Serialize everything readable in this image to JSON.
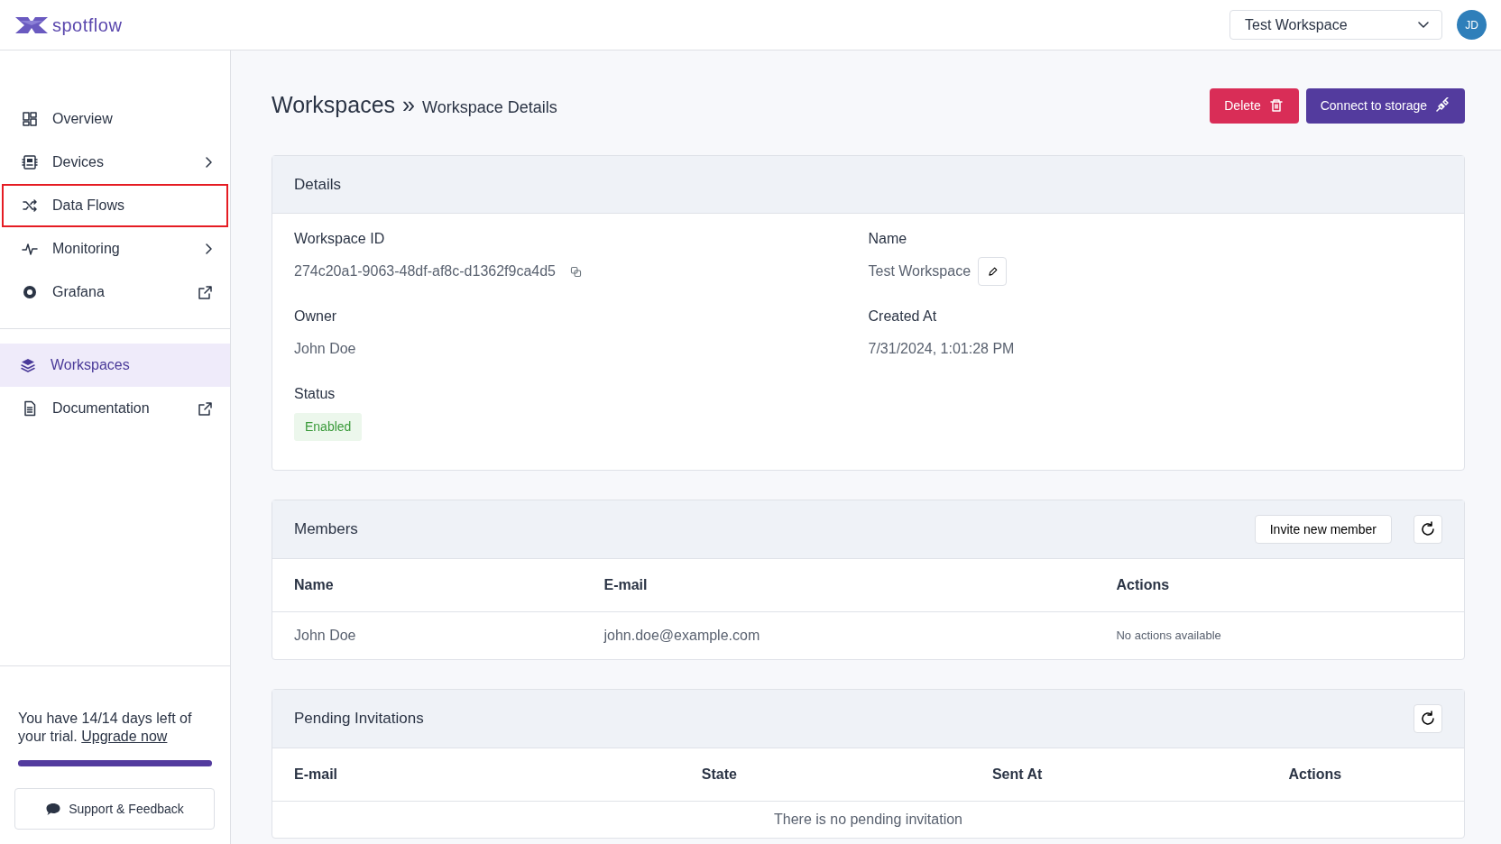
{
  "header": {
    "logo_text": "spotflow",
    "workspace_select": "Test Workspace",
    "avatar": "JD"
  },
  "sidebar": {
    "items": [
      {
        "label": "Overview",
        "kind": "plain",
        "selected": false,
        "highlighted": false
      },
      {
        "label": "Devices",
        "kind": "submenu",
        "selected": false,
        "highlighted": false
      },
      {
        "label": "Data Flows",
        "kind": "plain",
        "selected": false,
        "highlighted": true
      },
      {
        "label": "Monitoring",
        "kind": "submenu",
        "selected": false,
        "highlighted": false
      },
      {
        "label": "Grafana",
        "kind": "external",
        "selected": false,
        "highlighted": false
      }
    ],
    "bottom_items": [
      {
        "label": "Workspaces",
        "kind": "plain",
        "selected": true,
        "highlighted": false
      },
      {
        "label": "Documentation",
        "kind": "external",
        "selected": false,
        "highlighted": false
      }
    ],
    "trial": {
      "text": "You have 14/14 days left of your trial.",
      "link": "Upgrade now",
      "level": 1
    },
    "support_button": "Support & Feedback"
  },
  "page": {
    "breadcrumb": [
      "Workspaces",
      "»",
      "Workspace Details"
    ],
    "buttons": [
      {
        "label": "Delete",
        "kind": "danger"
      },
      {
        "label": "Connect to storage",
        "kind": "primary"
      }
    ]
  },
  "details": {
    "title": "Details",
    "fields": [
      {
        "label": "Workspace ID",
        "value": "274c20a1-9063-48df-af8c-d1362f9ca4d5",
        "kind": "copyable"
      },
      {
        "label": "Name",
        "value": "Test Workspace",
        "kind": "editable"
      },
      {
        "label": "Owner",
        "value": "John Doe",
        "kind": "text"
      },
      {
        "label": "Created At",
        "value": "7/31/2024, 1:01:28 PM",
        "kind": "text"
      },
      {
        "label": "Status",
        "value": "Enabled",
        "kind": "badge"
      }
    ]
  },
  "members": {
    "title": "Members",
    "invite_button": "Invite new member",
    "columns": [
      "Name",
      "E-mail",
      "Actions"
    ],
    "rows": [
      [
        "John Doe",
        "john.doe@example.com",
        "No actions available"
      ]
    ]
  },
  "pending": {
    "title": "Pending Invitations",
    "columns": [
      "E-mail",
      "State",
      "Sent At",
      "Actions"
    ],
    "empty_text": "There is no pending invitation"
  }
}
